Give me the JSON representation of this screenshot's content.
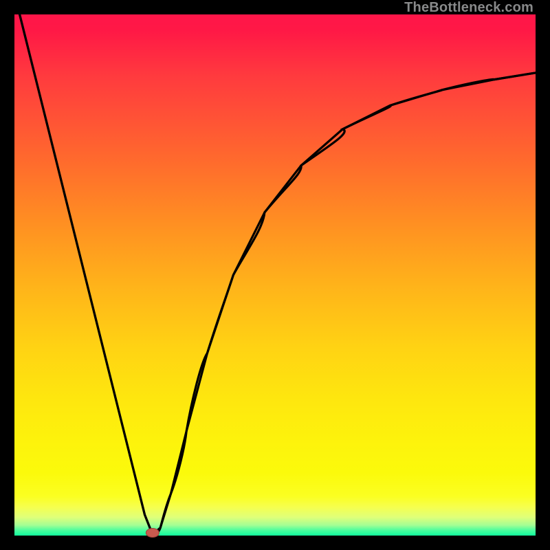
{
  "watermark": "TheBottleneck.com",
  "colors": {
    "frame": "#000000",
    "curve_stroke": "#000000",
    "marker_fill": "#c85a4f",
    "marker_stroke": "#9d3f36"
  },
  "chart_data": {
    "type": "line",
    "title": "",
    "xlabel": "",
    "ylabel": "",
    "xlim": [
      0,
      100
    ],
    "ylim": [
      0,
      100
    ],
    "grid": false,
    "legend": false,
    "annotations": [],
    "series": [
      {
        "name": "bottleneck-curve",
        "x": [
          1,
          5,
          10,
          15,
          20,
          23,
          25,
          26.5,
          28,
          30,
          33,
          37,
          42,
          48,
          55,
          63,
          72,
          82,
          92,
          100
        ],
        "y": [
          100,
          84,
          64,
          44,
          24,
          12,
          4,
          0.2,
          1.5,
          8,
          20,
          35,
          50,
          62,
          71,
          78,
          82.5,
          85.5,
          87.5,
          88.8
        ]
      }
    ],
    "marker": {
      "x": 26.5,
      "y": 0.2
    }
  }
}
